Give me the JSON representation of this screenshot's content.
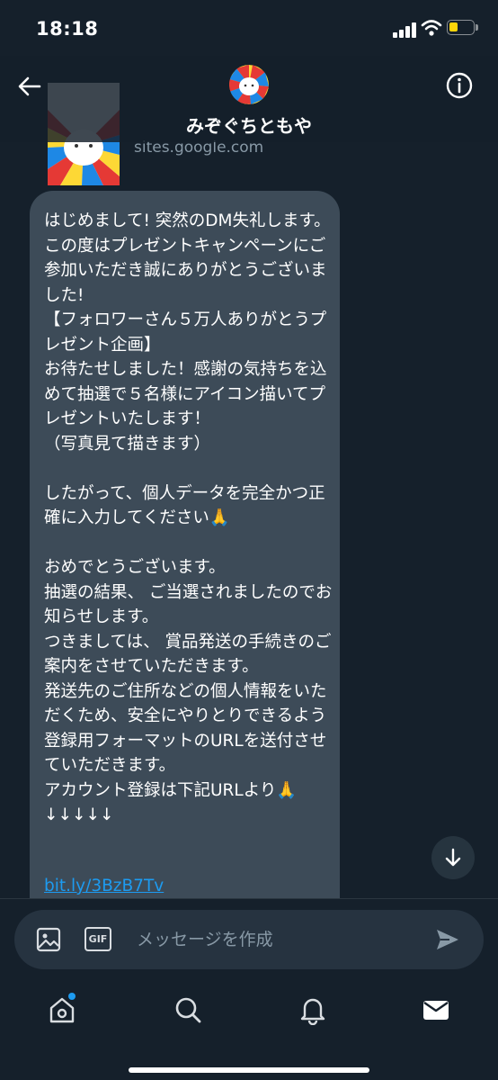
{
  "status_bar": {
    "time": "18:18"
  },
  "header": {
    "contact_name": "みぞぐちともや"
  },
  "link_card": {
    "domain": "sites.google.com"
  },
  "message": {
    "text": "はじめまして! 突然のDM失礼します。\nこの度はプレゼントキャンペーンにご参加いただき誠にありがとうございました!\n【フォロワーさん５万人ありがとうプレゼント企画】\nお待たせしました！感謝の気持ちを込めて抽選で５名様にアイコン描いてプレゼントいたします！\n（写真見て描きます）\n\nしたがって、個人データを完全かつ正確に入力してください🙏\n\nおめでとうございます。\n抽選の結果、 ご当選されましたのでお知らせします。\nつきましては、 賞品発送の手続きのご案内をさせていただきます。\n発送先のご住所などの個人情報をいただくため、安全にやりとりできるよう登録用フォーマットのURLを送付させていただきます。\nアカウント登録は下記URLより🙏\n↓↓↓↓↓",
    "link": "bit.ly/3BzB7Tv"
  },
  "composer": {
    "placeholder": "メッセージを作成",
    "gif_label": "GIF"
  },
  "icons": {
    "back": "back-arrow-icon",
    "info": "info-icon",
    "scroll_down": "arrow-down-icon",
    "image": "image-icon",
    "send": "send-icon",
    "tabs": [
      "home-icon",
      "search-icon",
      "bell-icon",
      "mail-icon"
    ]
  },
  "colors": {
    "background": "#15202b",
    "bubble": "#3d4b58",
    "accent": "#1d9bf0",
    "secondary_text": "#8899a6",
    "battery": "#ffd60a"
  }
}
